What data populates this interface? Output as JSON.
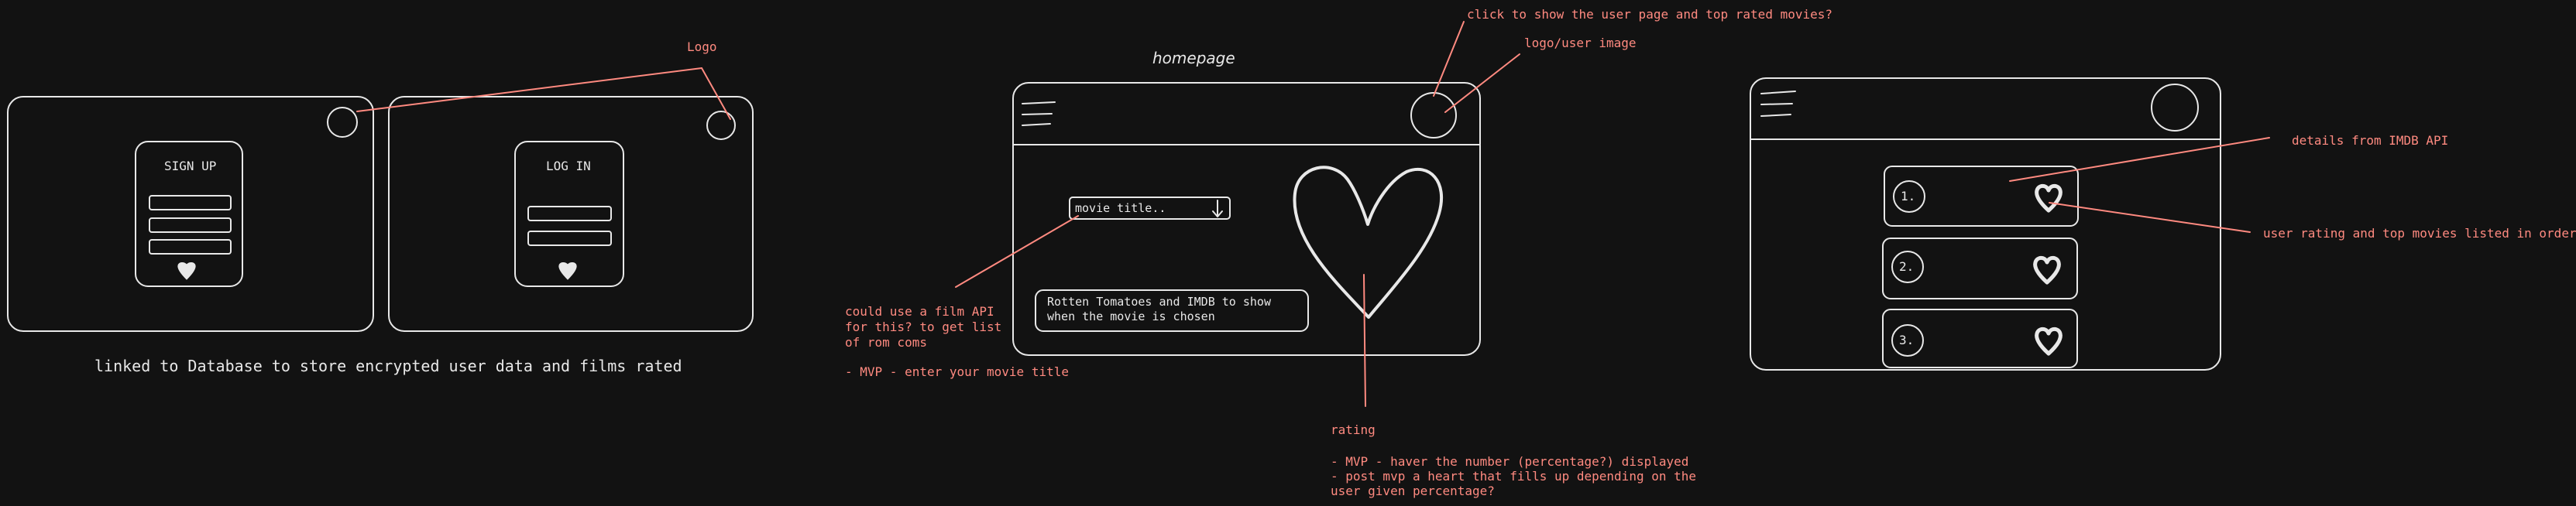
{
  "login_section": {
    "signup_title": "SIGN UP",
    "login_title": "LOG IN",
    "logo_note": "Logo",
    "database_note": "linked to Database to store encrypted user data and films rated"
  },
  "homepage_section": {
    "title": "homepage",
    "search_placeholder": "movie title..",
    "info_text_line1": "Rotten Tomatoes and IMDB to show",
    "info_text_line2": "when the movie is chosen",
    "note_click": "click to show the user page and top rated movies?",
    "note_logo": "logo/user image",
    "note_api_line1": "could use a film API",
    "note_api_line2": "for this? to get list",
    "note_api_line3": "of rom coms",
    "note_mvp_title": "- MVP - enter your movie title",
    "note_rating_title": "rating",
    "note_rating_line1": "- MVP - haver the number (percentage?) displayed",
    "note_rating_line2": "- post mvp a heart that fills up depending on the",
    "note_rating_line3": "user given percentage?"
  },
  "ranking_section": {
    "rows": [
      {
        "number": "1."
      },
      {
        "number": "2."
      },
      {
        "number": "3."
      }
    ],
    "note_details": "details from IMDB API",
    "note_user_rating": "user rating and top movies listed in order"
  },
  "colors": {
    "background": "#121212",
    "stroke": "#e8e8e8",
    "note": "#ff8a80"
  }
}
